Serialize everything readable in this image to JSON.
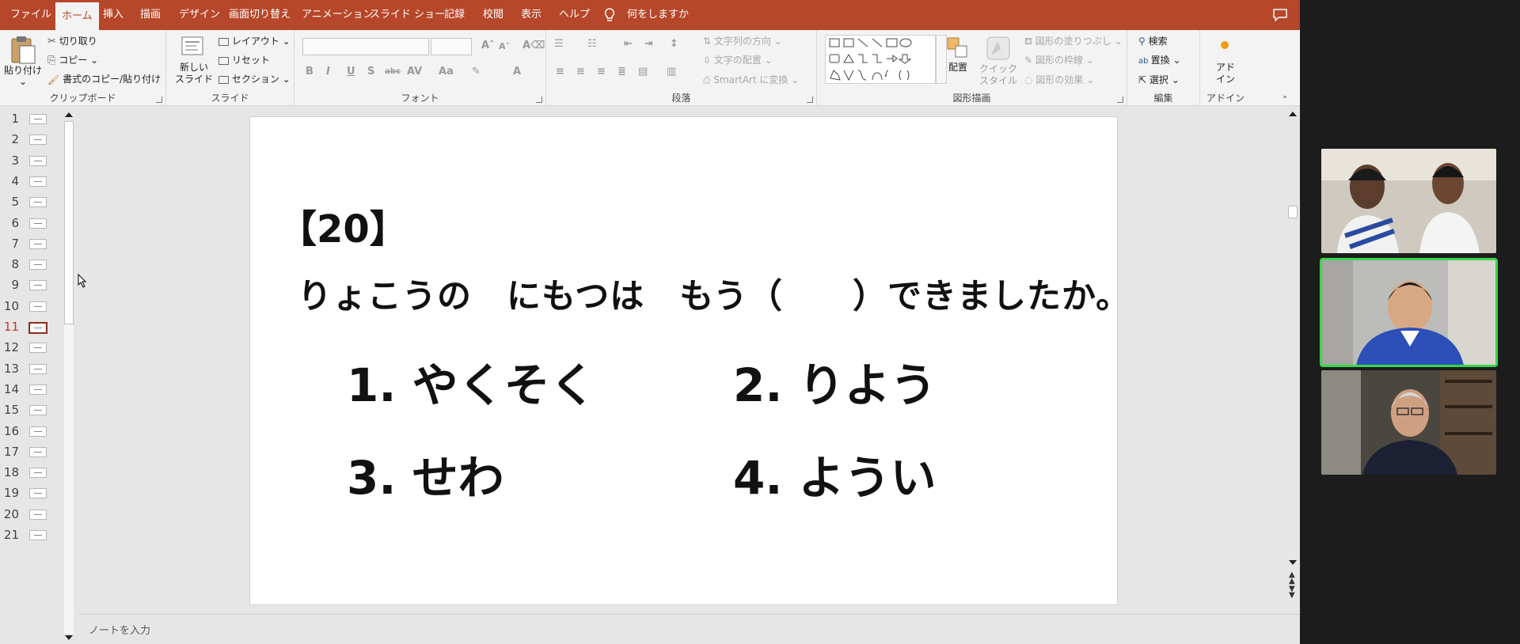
{
  "tabs": [
    {
      "label": "ファイル",
      "active": false
    },
    {
      "label": "ホーム",
      "active": true
    },
    {
      "label": "挿入",
      "active": false
    },
    {
      "label": "描画",
      "active": false
    },
    {
      "label": "デザイン",
      "active": false
    },
    {
      "label": "画面切り替え",
      "active": false
    },
    {
      "label": "アニメーション",
      "active": false
    },
    {
      "label": "スライド ショー",
      "active": false
    },
    {
      "label": "記録",
      "active": false
    },
    {
      "label": "校閲",
      "active": false
    },
    {
      "label": "表示",
      "active": false
    },
    {
      "label": "ヘルプ",
      "active": false
    }
  ],
  "tell_me": "何をしますか",
  "ribbon": {
    "clipboard": {
      "label": "クリップボード",
      "paste": "貼り付け",
      "cut": "切り取り",
      "copy": "コピー",
      "format_painter": "書式のコピー/貼り付け"
    },
    "slides": {
      "label": "スライド",
      "new_slide_line1": "新しい",
      "new_slide_line2": "スライド",
      "layout": "レイアウト",
      "reset": "リセット",
      "section": "セクション"
    },
    "font": {
      "label": "フォント",
      "buttons": [
        "B",
        "I",
        "U",
        "S",
        "abc",
        "AV",
        "Aa",
        "A"
      ]
    },
    "paragraph": {
      "label": "段落",
      "text_direction": "文字列の方向",
      "align_text": "文字の配置",
      "smartart": "SmartArt に変換"
    },
    "drawing": {
      "label": "図形描画",
      "arrange": "配置",
      "quick_styles_line1": "クイック",
      "quick_styles_line2": "スタイル",
      "shape_fill": "図形の塗りつぶし",
      "shape_outline": "図形の枠線",
      "shape_effects": "図形の効果"
    },
    "editing": {
      "label": "編集",
      "find": "検索",
      "replace": "置換",
      "select": "選択"
    },
    "addins": {
      "label": "アドイン",
      "button_line1": "アド",
      "button_line2": "イン"
    }
  },
  "thumbnails": [
    {
      "num": "1",
      "selected": false
    },
    {
      "num": "2",
      "selected": false
    },
    {
      "num": "3",
      "selected": false
    },
    {
      "num": "4",
      "selected": false
    },
    {
      "num": "5",
      "selected": false
    },
    {
      "num": "6",
      "selected": false
    },
    {
      "num": "7",
      "selected": false
    },
    {
      "num": "8",
      "selected": false
    },
    {
      "num": "9",
      "selected": false
    },
    {
      "num": "10",
      "selected": false
    },
    {
      "num": "11",
      "selected": true
    },
    {
      "num": "12",
      "selected": false
    },
    {
      "num": "13",
      "selected": false
    },
    {
      "num": "14",
      "selected": false
    },
    {
      "num": "15",
      "selected": false
    },
    {
      "num": "16",
      "selected": false
    },
    {
      "num": "17",
      "selected": false
    },
    {
      "num": "18",
      "selected": false
    },
    {
      "num": "19",
      "selected": false
    },
    {
      "num": "20",
      "selected": false
    },
    {
      "num": "21",
      "selected": false
    }
  ],
  "slide": {
    "number_label": "【20】",
    "question": "りょこうの　にもつは　もう（　　）できましたか。",
    "options": [
      "1. やくそく",
      "2. りよう",
      "3. せわ",
      "4. ようい"
    ]
  },
  "notes_placeholder": "ノートを入力",
  "colors": {
    "accent": "#b7472a",
    "active_speaker": "#36d84b",
    "selected_thumb": "#8b2d1e"
  },
  "participants": [
    {
      "name": "",
      "active": false
    },
    {
      "name": "",
      "active": true
    },
    {
      "name": "",
      "active": false
    }
  ]
}
